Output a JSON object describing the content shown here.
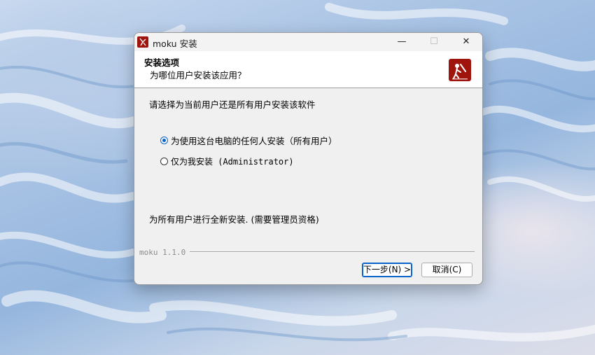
{
  "window": {
    "title": "moku 安装",
    "buttons": {
      "minimize": "—",
      "maximize": "☐",
      "close": "✕"
    }
  },
  "header": {
    "title": "安装选项",
    "subtitle": "为哪位用户安装该应用？"
  },
  "content": {
    "prompt": "请选择为当前用户还是所有用户安装该软件",
    "options": [
      {
        "label": "为使用这台电脑的任何人安装（所有用户）",
        "selected": true
      },
      {
        "label": "仅为我安装 (Administrator)",
        "selected": false
      }
    ],
    "description": "为所有用户进行全新安装. (需要管理员资格)"
  },
  "footer": {
    "version": "moku 1.1.0",
    "next_label": "下一步(N) >",
    "cancel_label": "取消(C)"
  },
  "colors": {
    "accent": "#0a63c8",
    "logo_red": "#a0140e"
  }
}
